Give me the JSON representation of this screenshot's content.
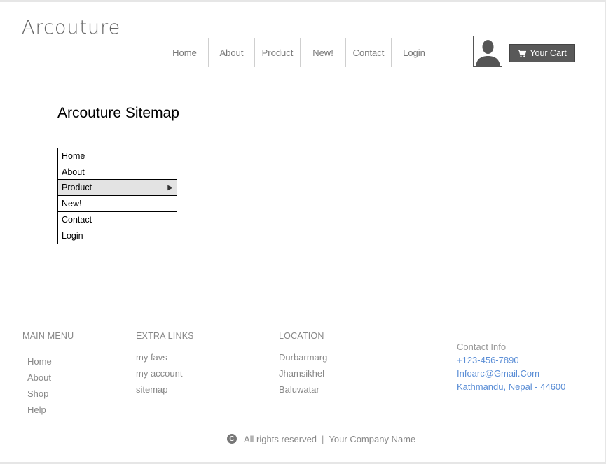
{
  "brand": {
    "logo": "Arcouture"
  },
  "nav": {
    "items": [
      {
        "label": "Home"
      },
      {
        "label": "About"
      },
      {
        "label": "Product"
      },
      {
        "label": "New!"
      },
      {
        "label": "Contact"
      },
      {
        "label": "Login"
      }
    ]
  },
  "header": {
    "cart_label": "Your Cart",
    "avatar_icon": "user-silhouette-icon",
    "cart_icon": "shopping-cart-icon"
  },
  "main": {
    "title": "Arcouture Sitemap",
    "sitemap": [
      {
        "label": "Home"
      },
      {
        "label": "About"
      },
      {
        "label": "Product",
        "has_submenu": true,
        "arrow": "▶"
      },
      {
        "label": "New!"
      },
      {
        "label": "Contact"
      },
      {
        "label": "Login"
      }
    ]
  },
  "footer": {
    "main_menu": {
      "heading": "MAIN MENU",
      "links": [
        "Home",
        "About",
        "Shop",
        "Help"
      ]
    },
    "extra_links": {
      "heading": "EXTRA LINKS",
      "links": [
        "my favs",
        "my account",
        "sitemap"
      ]
    },
    "location": {
      "heading": "LOCATION",
      "links": [
        "Durbarmarg",
        "Jhamsikhel",
        "Baluwatar"
      ]
    },
    "contact": {
      "heading": "Contact Info",
      "phone": "+123-456-7890",
      "email": "Infoarc@Gmail.Com",
      "address": "Kathmandu, Nepal - 44600"
    },
    "copyright": {
      "icon": "copyright-icon",
      "glyph": "C",
      "text": "All rights reserved",
      "separator": "|",
      "company": "Your Company Name"
    }
  },
  "colors": {
    "cart_bg": "#595959",
    "link_blue": "#5b8ed6",
    "active_row": "#e3e3e3"
  }
}
